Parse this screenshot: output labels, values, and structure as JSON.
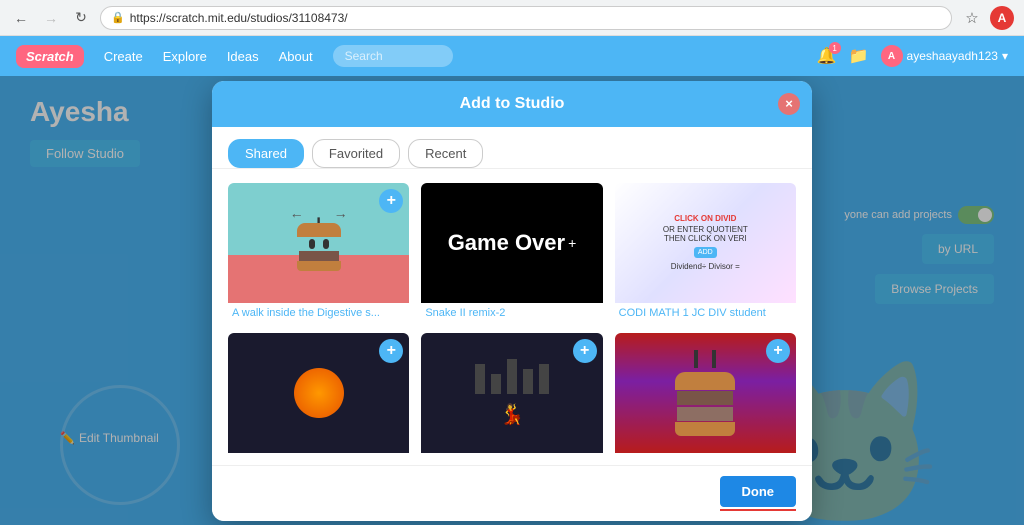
{
  "browser": {
    "url": "https://scratch.mit.edu/studios/31108473/",
    "back_disabled": false,
    "forward_disabled": true
  },
  "nav": {
    "logo": "Scratch",
    "links": [
      "Create",
      "Explore",
      "Ideas",
      "About"
    ],
    "search_placeholder": "Search",
    "username": "ayeshaayadh123",
    "notification_count": "1"
  },
  "page": {
    "studio_title": "Ayesha",
    "follow_btn": "Follow Studio",
    "anyone_label": "yone can add projects",
    "add_url_btn": "by URL",
    "browse_btn": "Browse Projects",
    "edit_thumbnail": "Edit Thumbnail"
  },
  "modal": {
    "title": "Add to Studio",
    "close_label": "×",
    "tabs": [
      "Shared",
      "Favorited",
      "Recent"
    ],
    "active_tab": 0,
    "projects": [
      {
        "name": "A walk inside the Digestive s...",
        "type": "digestive"
      },
      {
        "name": "Snake II remix-2",
        "type": "gameover"
      },
      {
        "name": "CODI MATH 1 JC DIV student",
        "type": "codi"
      },
      {
        "name": "",
        "type": "space"
      },
      {
        "name": "",
        "type": "dance"
      },
      {
        "name": "",
        "type": "burger2"
      }
    ],
    "done_btn": "Done"
  }
}
